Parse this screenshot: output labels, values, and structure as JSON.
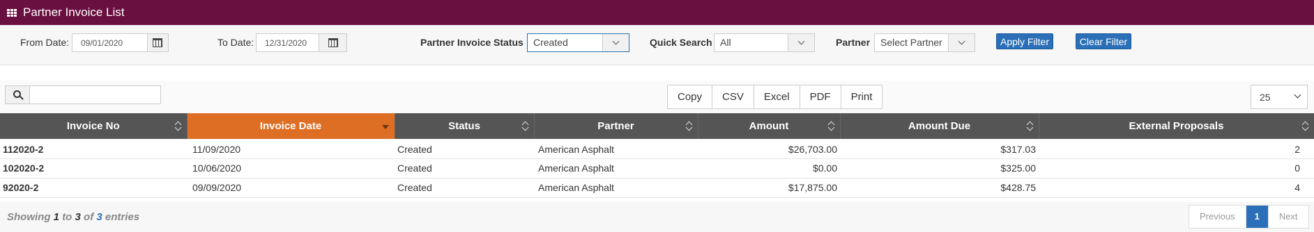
{
  "header": {
    "title": "Partner Invoice List",
    "icon": "grid-icon"
  },
  "filters": {
    "from_label": "From Date:",
    "from_value": "09/01/2020",
    "to_label": "To Date:",
    "to_value": "12/31/2020",
    "status_label": "Partner Invoice Status",
    "status_value": "Created",
    "quick_label": "Quick Search",
    "quick_value": "All",
    "partner_label": "Partner",
    "partner_value": "Select Partner",
    "apply_label": "Apply Filter",
    "clear_label": "Clear Filter"
  },
  "toolbar": {
    "search_value": "",
    "export_buttons": [
      "Copy",
      "CSV",
      "Excel",
      "PDF",
      "Print"
    ],
    "page_size": "25"
  },
  "table": {
    "columns": [
      "Invoice No",
      "Invoice Date",
      "Status",
      "Partner",
      "Amount",
      "Amount Due",
      "External Proposals"
    ],
    "sorted_column": "Invoice Date",
    "rows": [
      [
        "112020-2",
        "11/09/2020",
        "Created",
        "American Asphalt",
        "$26,703.00",
        "$317.03",
        "2"
      ],
      [
        "102020-2",
        "10/06/2020",
        "Created",
        "American Asphalt",
        "$0.00",
        "$325.00",
        "0"
      ],
      [
        "92020-2",
        "09/09/2020",
        "Created",
        "American Asphalt",
        "$17,875.00",
        "$428.75",
        "4"
      ]
    ]
  },
  "footer": {
    "showing_prefix": "Showing",
    "from": "1",
    "to_word": "to",
    "to": "3",
    "of_word": "of",
    "total": "3",
    "entries_word": "entries",
    "prev": "Previous",
    "page": "1",
    "next": "Next"
  },
  "colors": {
    "titlebar": "#6a1040",
    "sorted_header": "#dd6e23",
    "header": "#555555",
    "accent": "#2a6fb7"
  }
}
